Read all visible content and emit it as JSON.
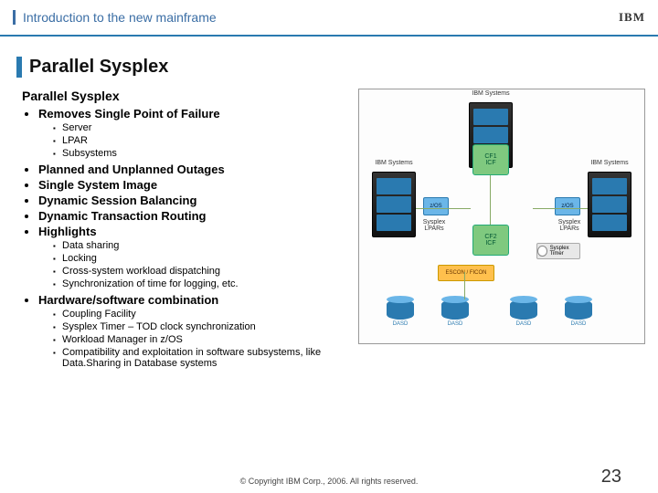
{
  "header": {
    "title": "Introduction to the new mainframe",
    "logo_text": "IBM"
  },
  "slide": {
    "title": "Parallel Sysplex"
  },
  "body": {
    "subheading": "Parallel Sysplex",
    "bullets": {
      "b0": {
        "title": "Removes Single Point of Failure",
        "sub": [
          "Server",
          "LPAR",
          "Subsystems"
        ]
      },
      "b1": {
        "title": "Planned and Unplanned Outages"
      },
      "b2": {
        "title": "Single System Image"
      },
      "b3": {
        "title": "Dynamic Session Balancing"
      },
      "b4": {
        "title": "Dynamic Transaction Routing"
      },
      "b5": {
        "title": "Highlights",
        "sub": [
          "Data sharing",
          "Locking",
          "Cross-system workload dispatching",
          "Synchronization of time for logging, etc."
        ]
      },
      "b6": {
        "title": "Hardware/software combination",
        "sub": [
          "Coupling Facility",
          "Sysplex Timer – TOD clock synchronization",
          "Workload Manager in z/OS",
          "Compatibility and exploitation in software subsystems, like Data.Sharing in Database systems"
        ]
      }
    }
  },
  "diagram": {
    "system_label": "IBM Systems",
    "cf1": "CF1",
    "cf2": "CF2",
    "icf": "ICF",
    "escon": "ESCON / FICON",
    "timer": "Sysplex Timer",
    "zos": "z/OS",
    "lpars": "Sysplex LPARs",
    "dasd": "DASD"
  },
  "footer": {
    "copyright": "© Copyright IBM Corp., 2006. All rights reserved.",
    "page": "23"
  }
}
